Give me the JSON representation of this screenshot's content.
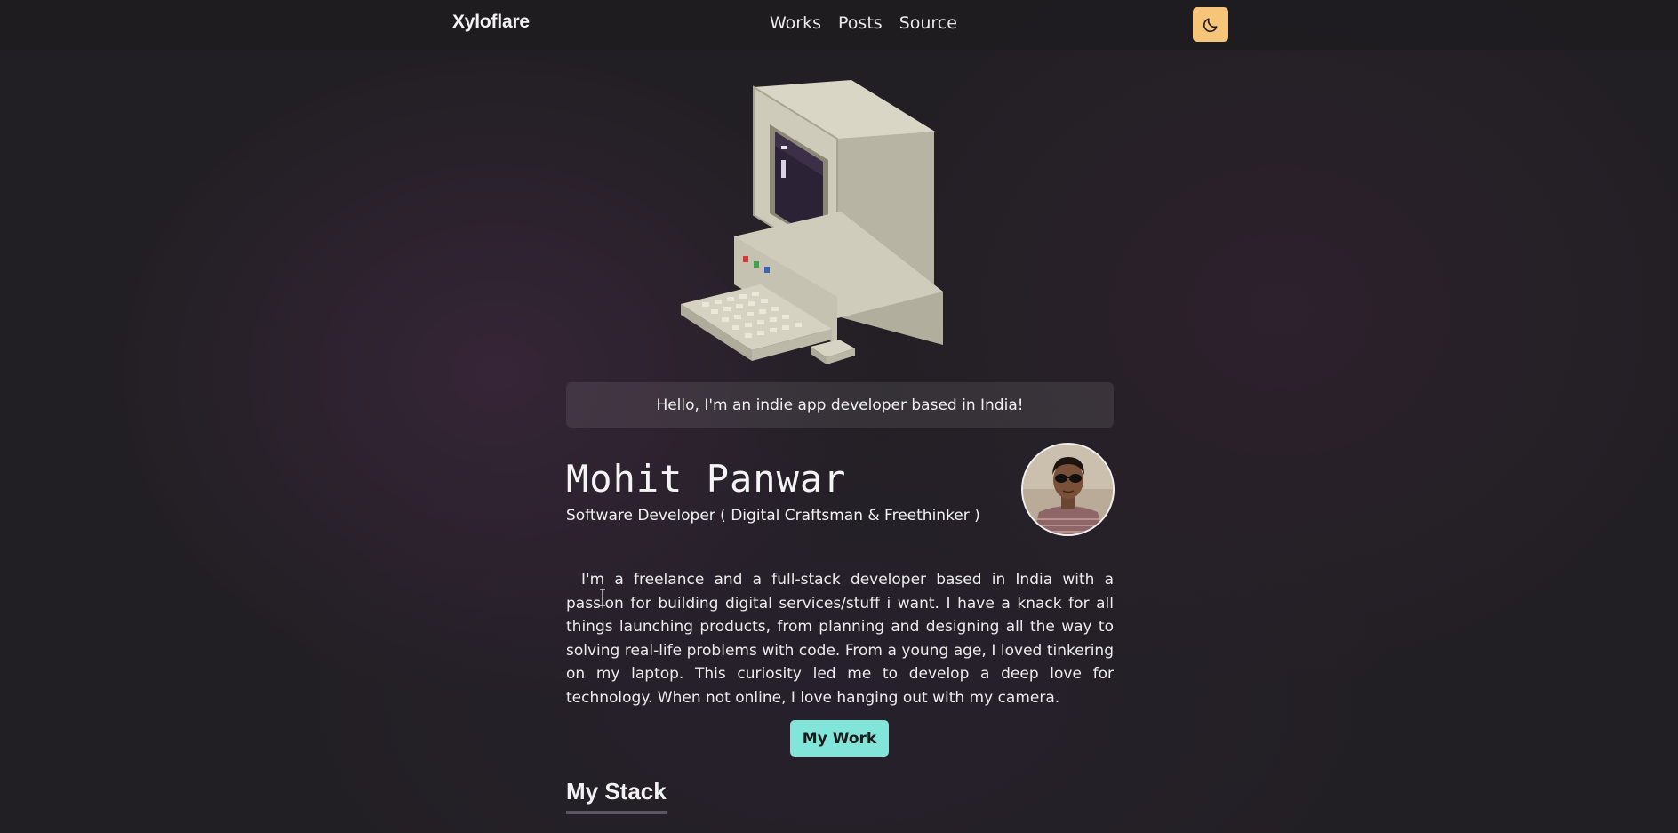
{
  "nav": {
    "brand": "Xyloflare",
    "links": [
      "Works",
      "Posts",
      "Source"
    ],
    "theme_toggle_icon": "moon-icon",
    "theme_toggle_color": "#f6c57a"
  },
  "hero": {
    "image": "retro-computer-voxel-illustration"
  },
  "greeting": "Hello, I'm an indie app developer based in India!",
  "profile": {
    "name": "Mohit Panwar",
    "role": "Software Developer ( Digital Craftsman & Freethinker )",
    "avatar": "profile-photo"
  },
  "bio": "I'm a freelance and a full-stack developer based in India with a passion for building digital services/stuff i want. I have a knack for all things launching products, from planning and designing all the way to solving real-life problems with code. From a young age, I loved tinkering on my laptop. This curiosity led me to develop a deep love for technology. When not online, I love hanging out with my camera.",
  "cta": {
    "label": "My Work",
    "color": "#81e6d9"
  },
  "sections": {
    "stack_heading": "My Stack"
  },
  "colors": {
    "background": "#221f24",
    "text": "#eaeaea"
  }
}
